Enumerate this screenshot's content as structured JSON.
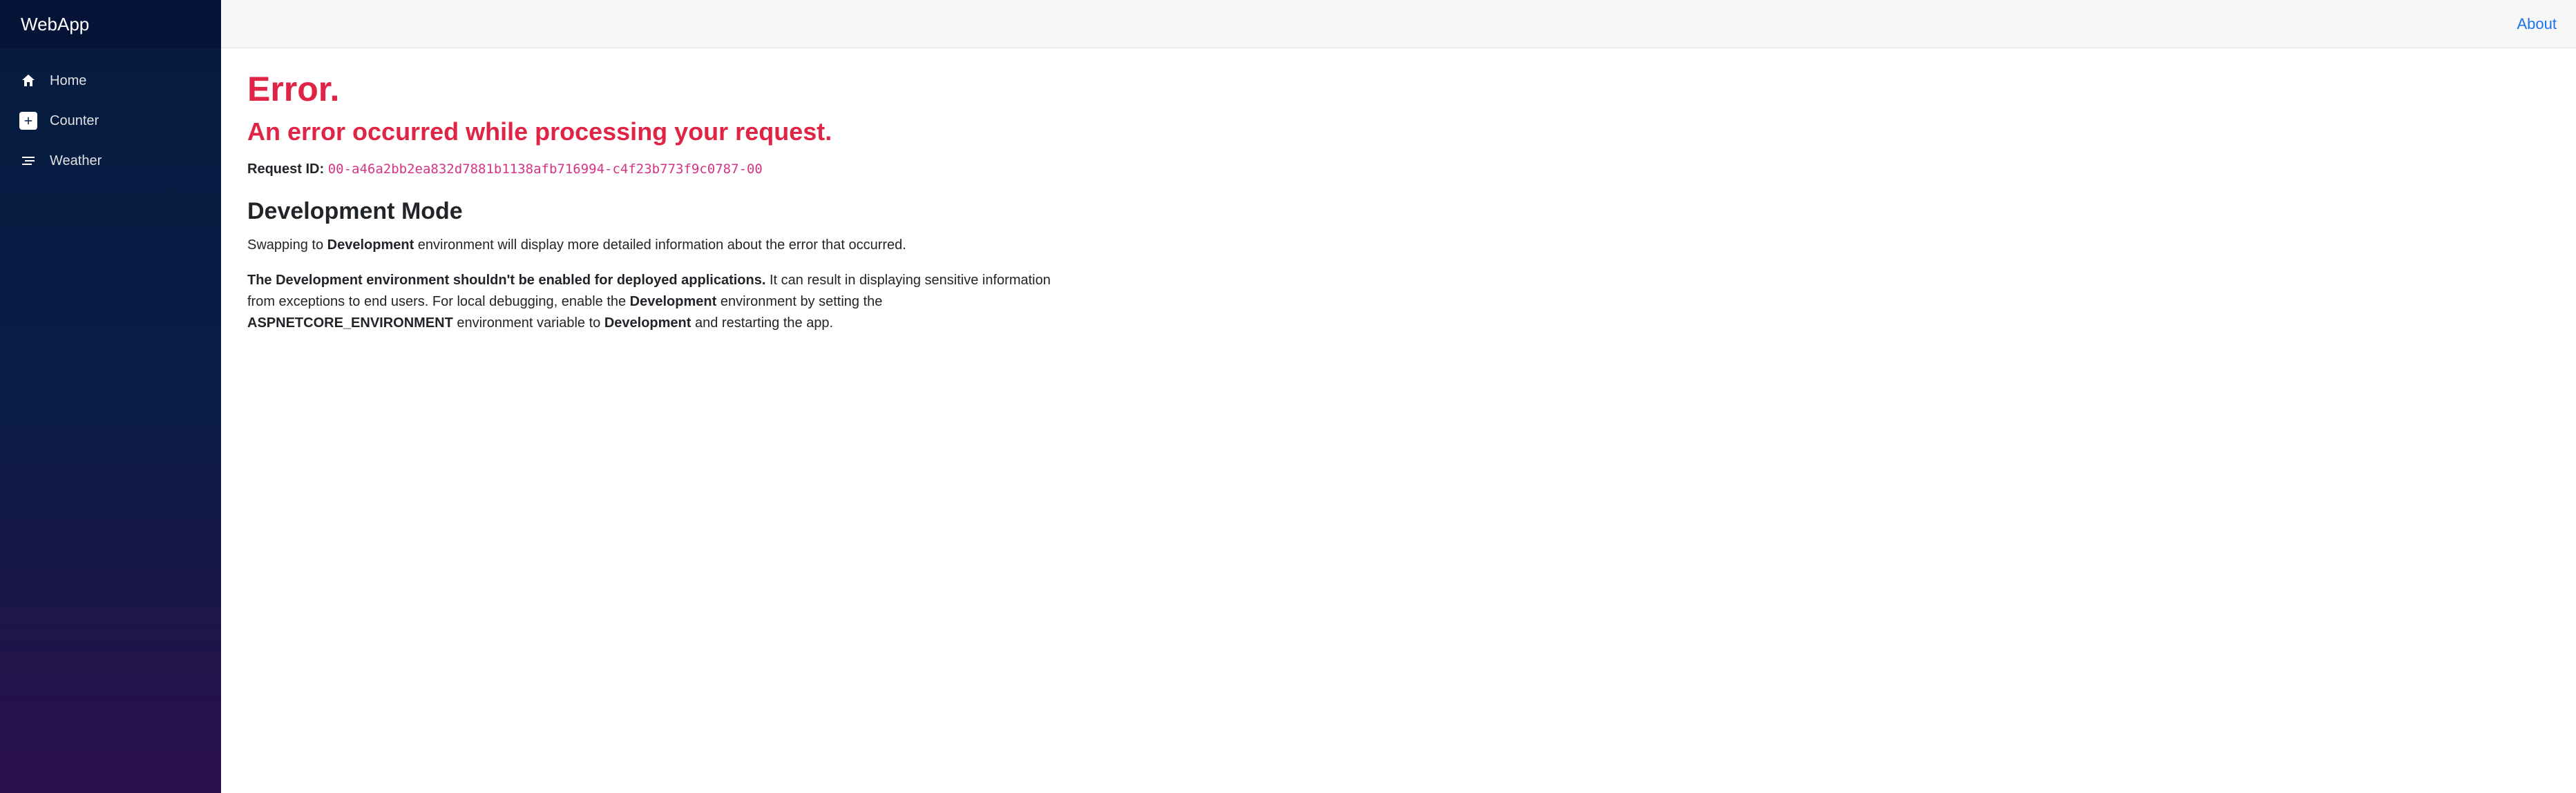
{
  "brand": "WebApp",
  "nav": {
    "items": [
      {
        "label": "Home",
        "icon": "home-icon"
      },
      {
        "label": "Counter",
        "icon": "plus-square-icon"
      },
      {
        "label": "Weather",
        "icon": "list-nested-icon"
      }
    ]
  },
  "topbar": {
    "about_label": "About"
  },
  "error": {
    "title": "Error.",
    "subtitle": "An error occurred while processing your request.",
    "request_id_label": "Request ID:",
    "request_id_value": "00-a46a2bb2ea832d7881b1138afb716994-c4f23b773f9c0787-00",
    "dev_heading": "Development Mode",
    "p1_a": "Swapping to ",
    "p1_b": "Development",
    "p1_c": " environment will display more detailed information about the error that occurred.",
    "p2_a": "The Development environment shouldn't be enabled for deployed applications.",
    "p2_b": " It can result in displaying sensitive information from exceptions to end users. For local debugging, enable the ",
    "p2_c": "Development",
    "p2_d": " environment by setting the ",
    "p2_e": "ASPNETCORE_ENVIRONMENT",
    "p2_f": " environment variable to ",
    "p2_g": "Development",
    "p2_h": " and restarting the app."
  }
}
